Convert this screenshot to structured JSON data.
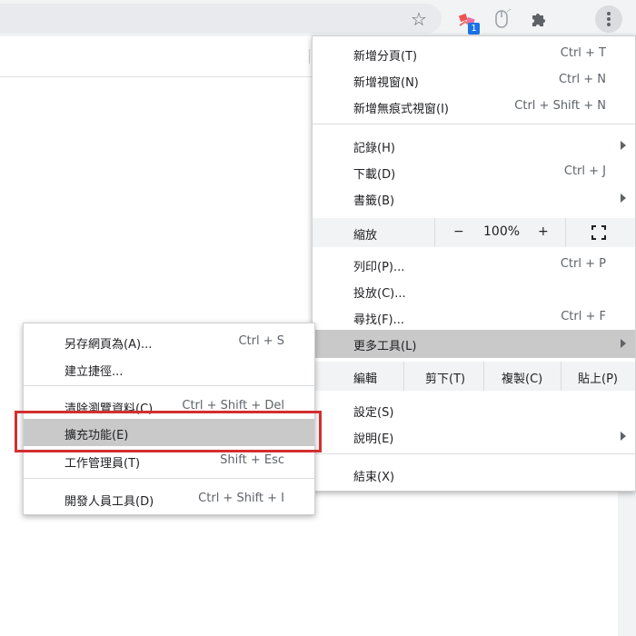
{
  "toolbar": {
    "icons": [
      "star-icon",
      "extension-shortcut-icon",
      "mouse-extension-icon",
      "puzzle-extensions-icon",
      "kebab-menu-icon"
    ],
    "ext_badge": "1"
  },
  "main_menu": {
    "items": [
      {
        "label": "新增分頁(T)",
        "shortcut": "Ctrl + T"
      },
      {
        "label": "新增視窗(N)",
        "shortcut": "Ctrl + N"
      },
      {
        "label": "新增無痕式視窗(I)",
        "shortcut": "Ctrl + Shift + N"
      },
      {
        "label": "記錄(H)",
        "shortcut": ""
      },
      {
        "label": "下載(D)",
        "shortcut": "Ctrl + J"
      },
      {
        "label": "書籤(B)",
        "shortcut": ""
      },
      {
        "label": "列印(P)...",
        "shortcut": "Ctrl + P"
      },
      {
        "label": "投放(C)...",
        "shortcut": ""
      },
      {
        "label": "尋找(F)...",
        "shortcut": "Ctrl + F"
      },
      {
        "label": "更多工具(L)",
        "shortcut": ""
      },
      {
        "label": "設定(S)",
        "shortcut": ""
      },
      {
        "label": "說明(E)",
        "shortcut": ""
      },
      {
        "label": "結束(X)",
        "shortcut": ""
      }
    ],
    "zoom": {
      "label": "縮放",
      "minus": "−",
      "value": "100%",
      "plus": "+"
    },
    "edit": {
      "label": "編輯",
      "cut": "剪下(T)",
      "copy": "複製(C)",
      "paste": "貼上(P)"
    }
  },
  "sub_menu": {
    "items": [
      {
        "label": "另存網頁為(A)...",
        "shortcut": "Ctrl + S"
      },
      {
        "label": "建立捷徑...",
        "shortcut": ""
      },
      {
        "label": "清除瀏覽資料(C)...",
        "shortcut": "Ctrl + Shift + Del"
      },
      {
        "label": "擴充功能(E)",
        "shortcut": ""
      },
      {
        "label": "工作管理員(T)",
        "shortcut": "Shift + Esc"
      },
      {
        "label": "開發人員工具(D)",
        "shortcut": "Ctrl + Shift + I"
      }
    ]
  },
  "colors": {
    "highlight": "#c9c9c9",
    "annotation_box": "#d32f2f",
    "badge": "#1a73e8"
  }
}
